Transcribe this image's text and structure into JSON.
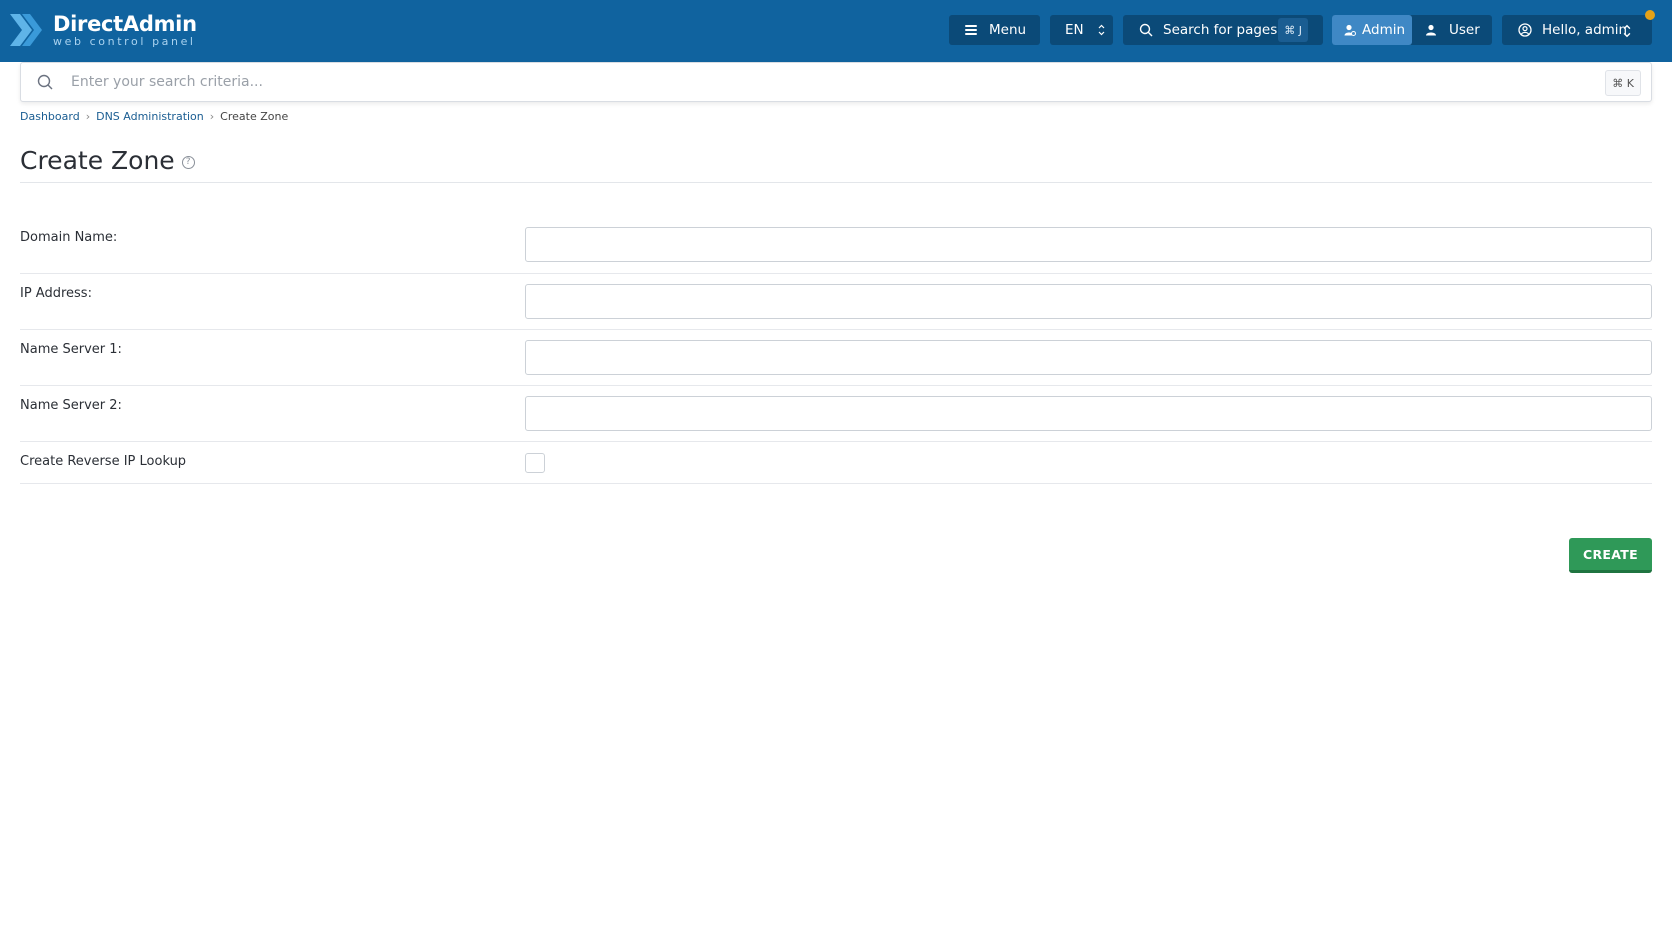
{
  "app": {
    "logo_title": "DirectAdmin",
    "logo_subtitle": "web control panel"
  },
  "topbar": {
    "menu_label": "Menu",
    "language": "EN",
    "search_pages_label": "Search for pages",
    "search_pages_shortcut": "⌘ J",
    "role_admin": "Admin",
    "role_user": "User",
    "greeting": "Hello, admin",
    "notification_color": "#e6a217"
  },
  "search": {
    "placeholder": "Enter your search criteria...",
    "shortcut": "⌘ K"
  },
  "breadcrumb": {
    "items": [
      "Dashboard",
      "DNS Administration",
      "Create Zone"
    ]
  },
  "page": {
    "title": "Create Zone",
    "help_icon": "?"
  },
  "form": {
    "fields": [
      {
        "label": "Domain Name:",
        "value": ""
      },
      {
        "label": "IP Address:",
        "value": ""
      },
      {
        "label": "Name Server 1:",
        "value": ""
      },
      {
        "label": "Name Server 2:",
        "value": ""
      }
    ],
    "reverse_lookup_label": "Create Reverse IP Lookup",
    "reverse_lookup_checked": false,
    "submit_label": "CREATE"
  },
  "colors": {
    "topbar": "#10639f",
    "accent_green": "#2f9958"
  }
}
